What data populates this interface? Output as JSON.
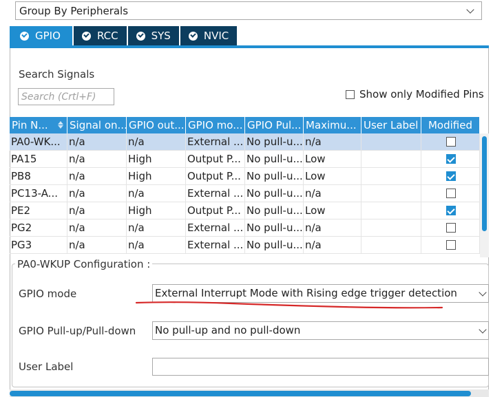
{
  "group_select": {
    "value": "Group By Peripherals"
  },
  "tabs": [
    {
      "label": "GPIO",
      "active": true
    },
    {
      "label": "RCC",
      "active": false
    },
    {
      "label": "SYS",
      "active": false
    },
    {
      "label": "NVIC",
      "active": false
    }
  ],
  "search": {
    "title": "Search Signals",
    "placeholder": "Search (Crtl+F)"
  },
  "show_modified": {
    "label": "Show only Modified Pins",
    "checked": false
  },
  "table": {
    "headers": [
      "Pin N...",
      "Signal on...",
      "GPIO out...",
      "GPIO mo...",
      "GPIO Pul...",
      "Maximu...",
      "User Label",
      "Modified"
    ],
    "rows": [
      {
        "pin": "PA0-WK...",
        "signal": "n/a",
        "output": "n/a",
        "mode": "External ...",
        "pull": "No pull-u...",
        "max": "n/a",
        "user_label": "",
        "modified": false,
        "selected": true
      },
      {
        "pin": "PA15",
        "signal": "n/a",
        "output": "High",
        "mode": "Output P...",
        "pull": "No pull-u...",
        "max": "Low",
        "user_label": "",
        "modified": true,
        "selected": false
      },
      {
        "pin": "PB8",
        "signal": "n/a",
        "output": "High",
        "mode": "Output P...",
        "pull": "No pull-u...",
        "max": "Low",
        "user_label": "",
        "modified": true,
        "selected": false
      },
      {
        "pin": "PC13-A...",
        "signal": "n/a",
        "output": "n/a",
        "mode": "External ...",
        "pull": "No pull-u...",
        "max": "n/a",
        "user_label": "",
        "modified": false,
        "selected": false
      },
      {
        "pin": "PE2",
        "signal": "n/a",
        "output": "High",
        "mode": "Output P...",
        "pull": "No pull-u...",
        "max": "Low",
        "user_label": "",
        "modified": true,
        "selected": false
      },
      {
        "pin": "PG2",
        "signal": "n/a",
        "output": "n/a",
        "mode": "External ...",
        "pull": "No pull-u...",
        "max": "n/a",
        "user_label": "",
        "modified": false,
        "selected": false
      },
      {
        "pin": "PG3",
        "signal": "n/a",
        "output": "n/a",
        "mode": "External ...",
        "pull": "No pull-u...",
        "max": "n/a",
        "user_label": "",
        "modified": false,
        "selected": false
      }
    ]
  },
  "config": {
    "title": "PA0-WKUP Configuration :",
    "gpio_mode": {
      "label": "GPIO mode",
      "value": "External Interrupt Mode with Rising edge trigger detection"
    },
    "pull": {
      "label": "GPIO Pull-up/Pull-down",
      "value": "No pull-up and no pull-down"
    },
    "user_label": {
      "label": "User Label",
      "value": ""
    }
  },
  "colors": {
    "accent": "#1f8ed1",
    "tab_dark": "#0c3d5e",
    "annotation": "#d62828",
    "selected_row": "#c8daf0"
  }
}
